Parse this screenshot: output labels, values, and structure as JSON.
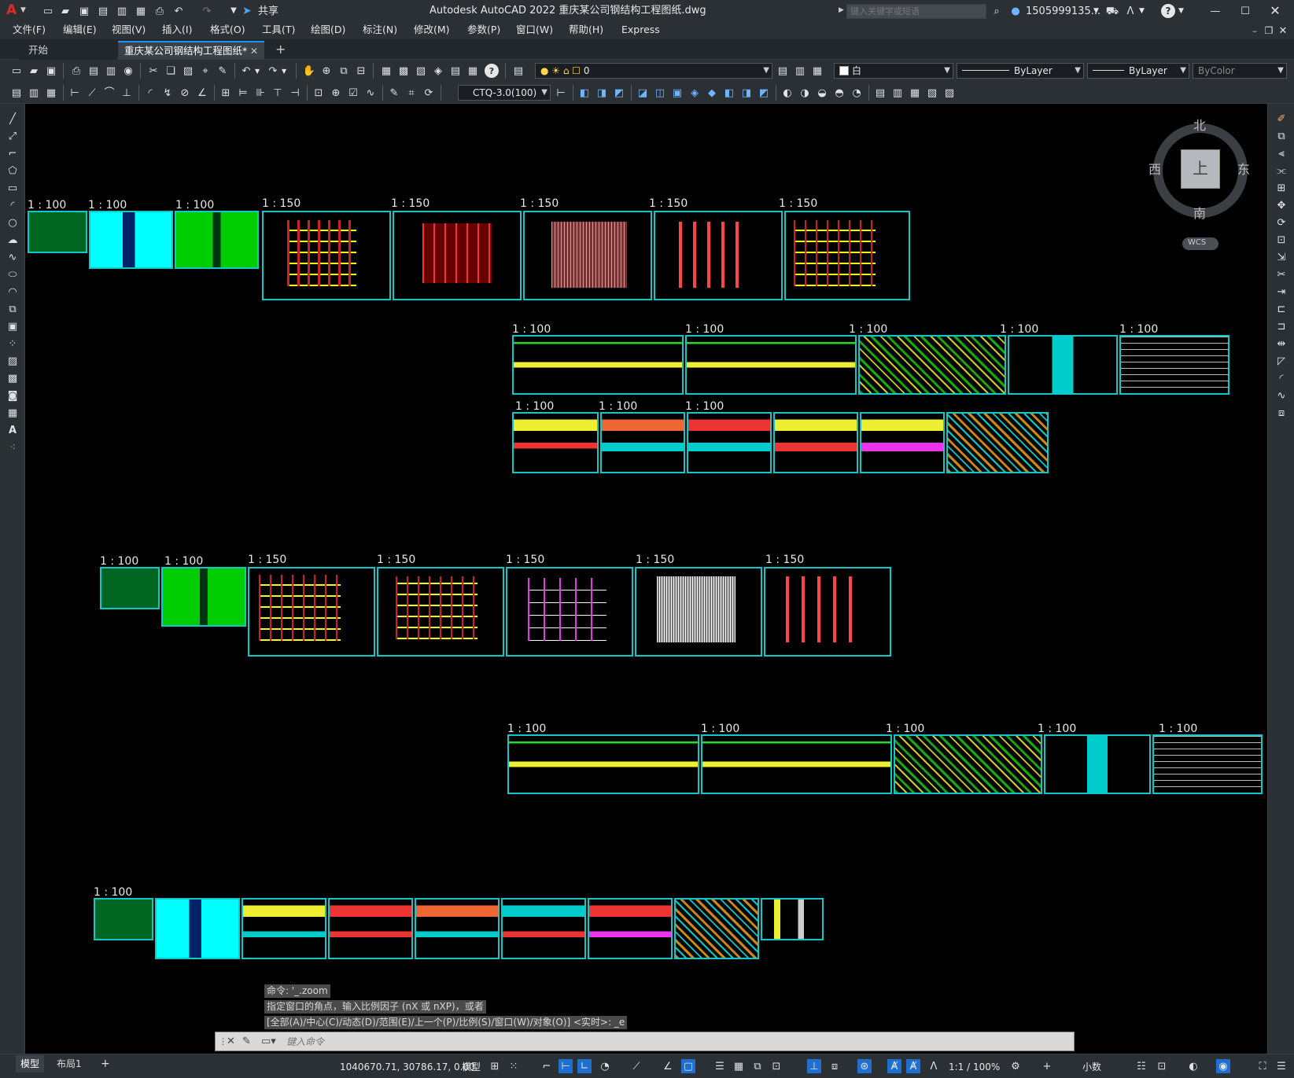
{
  "titlebar": {
    "app_logo": "A",
    "share_label": "共享",
    "title": "Autodesk AutoCAD 2022    重庆某公司钢结构工程图纸.dwg",
    "search_placeholder": "键入关键字或短语",
    "user": "1505999135...",
    "icons": [
      "new-icon",
      "open-icon",
      "save-icon",
      "saveas-icon",
      "open-web-icon",
      "save-web-icon",
      "plot-icon",
      "undo-icon",
      "redo-icon",
      "share-icon",
      "search-icon",
      "user-icon",
      "cart-icon",
      "autodesk-icon",
      "help-icon",
      "minimize-icon",
      "maximize-icon",
      "close-icon"
    ]
  },
  "menubar": {
    "items": [
      "文件(F)",
      "编辑(E)",
      "视图(V)",
      "插入(I)",
      "格式(O)",
      "工具(T)",
      "绘图(D)",
      "标注(N)",
      "修改(M)",
      "参数(P)",
      "窗口(W)",
      "帮助(H)",
      "Express"
    ]
  },
  "tabs": {
    "items": [
      "开始",
      "重庆某公司钢结构工程图纸*"
    ],
    "active_index": 1,
    "add_label": "+"
  },
  "properties": {
    "layer": "0",
    "color": "白",
    "linetype": "ByLayer",
    "lineweight": "ByLayer",
    "plotstyle": "ByColor",
    "dimstyle": "CTQ-3.0(100)"
  },
  "viewcube": {
    "north": "北",
    "south": "南",
    "east": "东",
    "west": "西",
    "top": "上",
    "wcs": "WCS"
  },
  "drawing": {
    "sheet_color": "#11c8c8",
    "rows": [
      {
        "scales": [
          "1 : 100",
          "1 : 100",
          "1 : 100",
          "1 : 150",
          "1 : 150",
          "1 : 150",
          "1 : 150",
          "1 : 150"
        ]
      },
      {
        "scales": [
          "1 : 100",
          "1 : 100",
          "1 : 100",
          "1 : 100",
          "1 : 100"
        ]
      },
      {
        "scales": [
          "1 : 100",
          "1 : 100",
          "1 : 100"
        ]
      },
      {
        "scales": [
          "1 : 100",
          "1 : 100",
          "1 : 150",
          "1 : 150",
          "1 : 150",
          "1 : 150",
          "1 : 150"
        ]
      },
      {
        "scales": [
          "1 : 100",
          "1 : 100",
          "1 : 100",
          "1 : 100",
          "1 : 100"
        ]
      },
      {
        "scales": [
          "1 : 100"
        ]
      }
    ]
  },
  "command": {
    "history": [
      "命令: '_.zoom",
      "指定窗口的角点，输入比例因子 (nX 或 nXP)，或者",
      "[全部(A)/中心(C)/动态(D)/范围(E)/上一个(P)/比例(S)/窗口(W)/对象(O)] <实时>: _e"
    ],
    "placeholder": "键入命令"
  },
  "statusbar": {
    "tabs": [
      "模型",
      "布局1"
    ],
    "add_label": "+",
    "coordinates": "1040670.71, 30786.17, 0.00",
    "mode": "模型",
    "scale": "1:1 / 100%",
    "units": "小数"
  }
}
